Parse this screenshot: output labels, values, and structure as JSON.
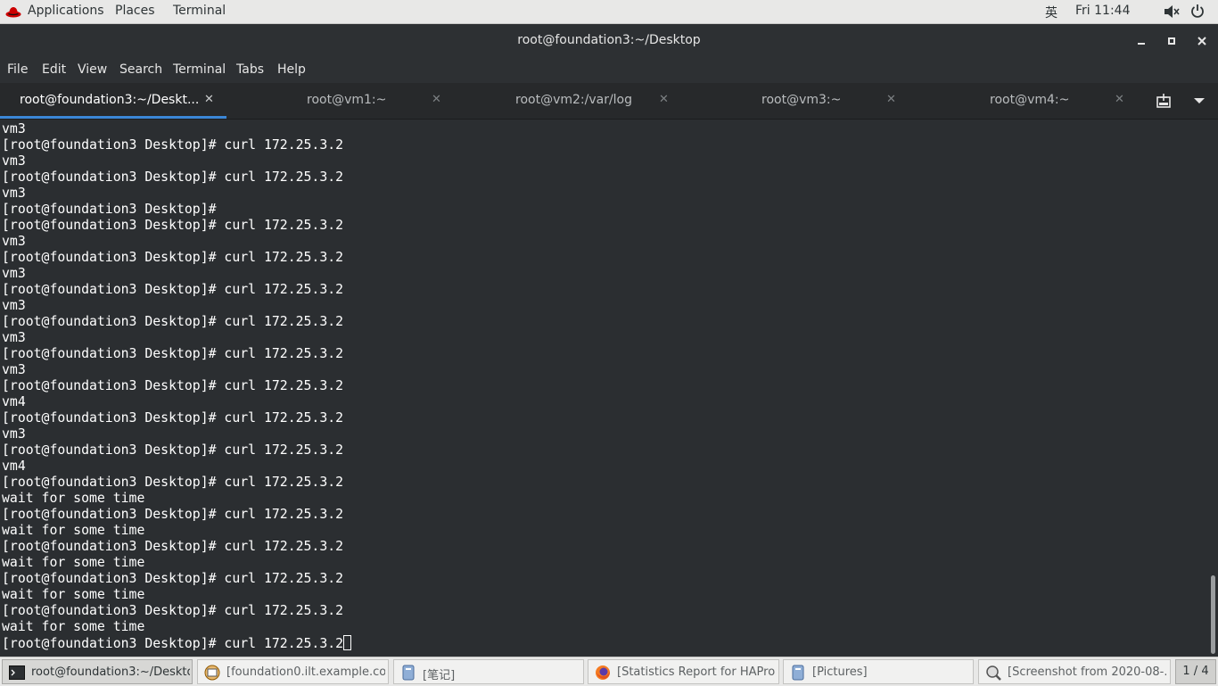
{
  "top_panel": {
    "applications": "Applications",
    "places": "Places",
    "terminal": "Terminal",
    "input_method": "英",
    "clock": "Fri 11:44"
  },
  "window": {
    "title": "root@foundation3:~/Desktop"
  },
  "menu": [
    "File",
    "Edit",
    "View",
    "Search",
    "Terminal",
    "Tabs",
    "Help"
  ],
  "tabs": [
    {
      "label": "root@foundation3:~/Deskt...",
      "active": true
    },
    {
      "label": "root@vm1:~",
      "active": false
    },
    {
      "label": "root@vm2:/var/log",
      "active": false
    },
    {
      "label": "root@vm3:~",
      "active": false
    },
    {
      "label": "root@vm4:~",
      "active": false
    }
  ],
  "terminal_lines": [
    "vm3",
    "[root@foundation3 Desktop]# curl 172.25.3.2",
    "vm3",
    "[root@foundation3 Desktop]# curl 172.25.3.2",
    "vm3",
    "[root@foundation3 Desktop]#",
    "[root@foundation3 Desktop]# curl 172.25.3.2",
    "vm3",
    "[root@foundation3 Desktop]# curl 172.25.3.2",
    "vm3",
    "[root@foundation3 Desktop]# curl 172.25.3.2",
    "vm3",
    "[root@foundation3 Desktop]# curl 172.25.3.2",
    "vm3",
    "[root@foundation3 Desktop]# curl 172.25.3.2",
    "vm3",
    "[root@foundation3 Desktop]# curl 172.25.3.2",
    "vm4",
    "[root@foundation3 Desktop]# curl 172.25.3.2",
    "vm3",
    "[root@foundation3 Desktop]# curl 172.25.3.2",
    "vm4",
    "[root@foundation3 Desktop]# curl 172.25.3.2",
    "wait for some time",
    "[root@foundation3 Desktop]# curl 172.25.3.2",
    "wait for some time",
    "[root@foundation3 Desktop]# curl 172.25.3.2",
    "wait for some time",
    "[root@foundation3 Desktop]# curl 172.25.3.2",
    "wait for some time",
    "[root@foundation3 Desktop]# curl 172.25.3.2",
    "wait for some time",
    "[root@foundation3 Desktop]# curl 172.25.3.2"
  ],
  "taskbar": {
    "items": [
      {
        "label": "root@foundation3:~/Desktop",
        "icon": "terminal-icon",
        "active": true
      },
      {
        "label": "[foundation0.ilt.example.co...",
        "icon": "virt-viewer-icon",
        "active": false
      },
      {
        "label": "[笔记]",
        "icon": "file-manager-icon",
        "active": false
      },
      {
        "label": "[Statistics Report for HAPro...",
        "icon": "firefox-icon",
        "active": false
      },
      {
        "label": "[Pictures]",
        "icon": "file-manager-icon",
        "active": false
      },
      {
        "label": "[Screenshot from 2020-08-...",
        "icon": "screenshot-icon",
        "active": false
      }
    ],
    "workspace": "1 / 4"
  },
  "colors": {
    "terminal_bg": "#2b2e31",
    "terminal_fg": "#ffffff",
    "active_tab_underline": "#3b86d6",
    "panel_bg": "#e8e8e7"
  }
}
